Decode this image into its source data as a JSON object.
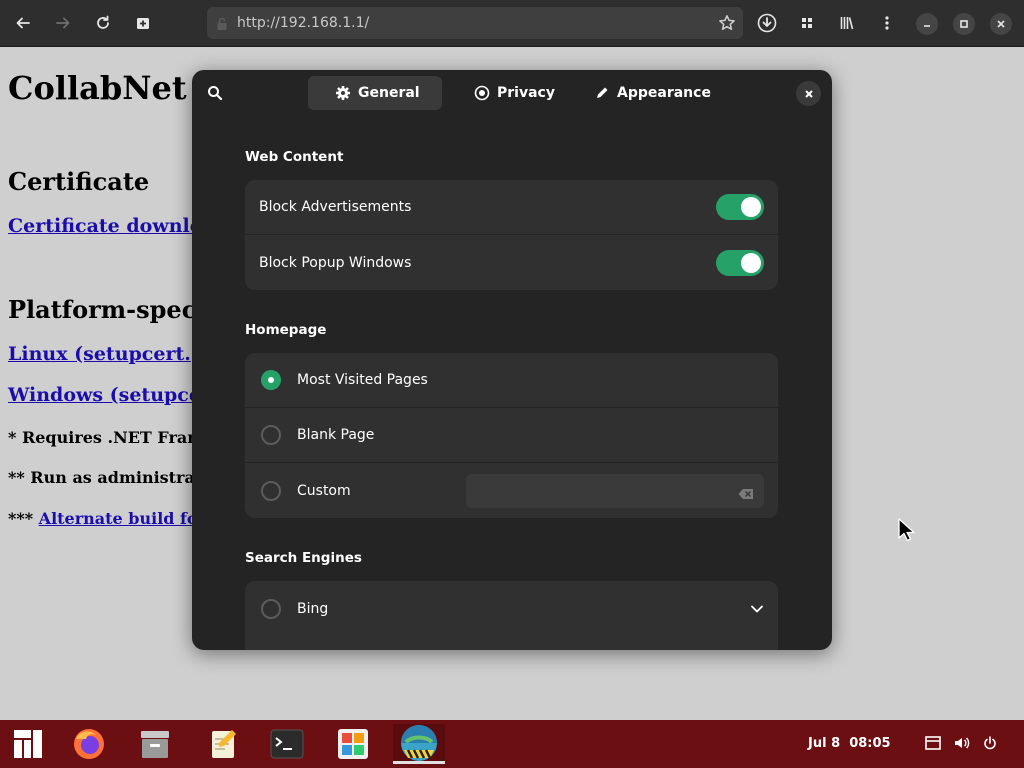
{
  "browser": {
    "url": "http://192.168.1.1/"
  },
  "page": {
    "title": "CollabNet",
    "cert_heading": "Certificate",
    "cert_link": "Certificate downlo",
    "platform_heading": "Platform-spec",
    "linux_link": "Linux (setupcert.",
    "windows_link": "Windows (setupce",
    "note1": "* Requires .NET Fran",
    "note2": "** Run as administra",
    "note3_prefix": "*** ",
    "note3_link": "Alternate build fo"
  },
  "dialog": {
    "tabs": [
      {
        "label": "General",
        "icon": "gear-icon"
      },
      {
        "label": "Privacy",
        "icon": "privacy-icon"
      },
      {
        "label": "Appearance",
        "icon": "pencil-icon"
      }
    ],
    "web_content": {
      "title": "Web Content",
      "rows": [
        {
          "label": "Block Advertisements",
          "enabled": true
        },
        {
          "label": "Block Popup Windows",
          "enabled": true
        }
      ]
    },
    "homepage": {
      "title": "Homepage",
      "options": [
        {
          "label": "Most Visited Pages",
          "selected": true
        },
        {
          "label": "Blank Page",
          "selected": false
        },
        {
          "label": "Custom",
          "selected": false
        }
      ],
      "custom_value": ""
    },
    "search_engines": {
      "title": "Search Engines",
      "options": [
        {
          "label": "Bing",
          "selected": false
        }
      ]
    }
  },
  "taskbar": {
    "date": "Jul 8",
    "time": "08:05"
  },
  "colors": {
    "accent": "#26a269",
    "taskbar": "#6c0f12",
    "dialog_bg": "#242424"
  }
}
